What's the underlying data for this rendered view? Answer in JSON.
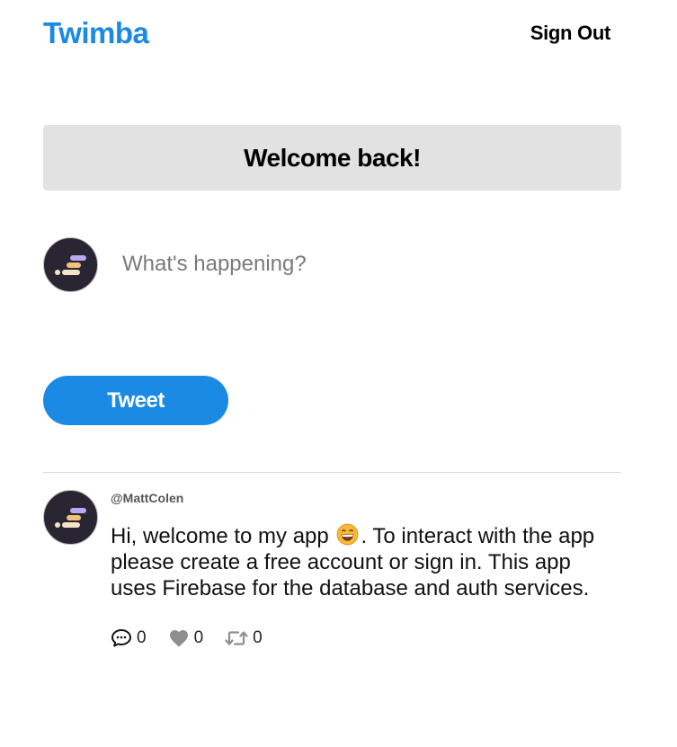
{
  "header": {
    "logo": "Twimba",
    "signout_label": "Sign Out"
  },
  "welcome": {
    "title": "Welcome back!"
  },
  "composer": {
    "placeholder": "What's happening?",
    "button_label": "Tweet"
  },
  "feed": [
    {
      "handle": "@MattColen",
      "text_before_emoji": "Hi, welcome to my app",
      "emoji": "grinning-face-icon",
      "text_after_emoji": ". To interact with the app please create a free account or sign in. This app uses Firebase for the database and auth services.",
      "replies": "0",
      "likes": "0",
      "retweets": "0"
    }
  ],
  "colors": {
    "brand": "#1a8ae5",
    "welcome_bg": "#e2e2e2",
    "avatar_bg": "#2a2533"
  }
}
